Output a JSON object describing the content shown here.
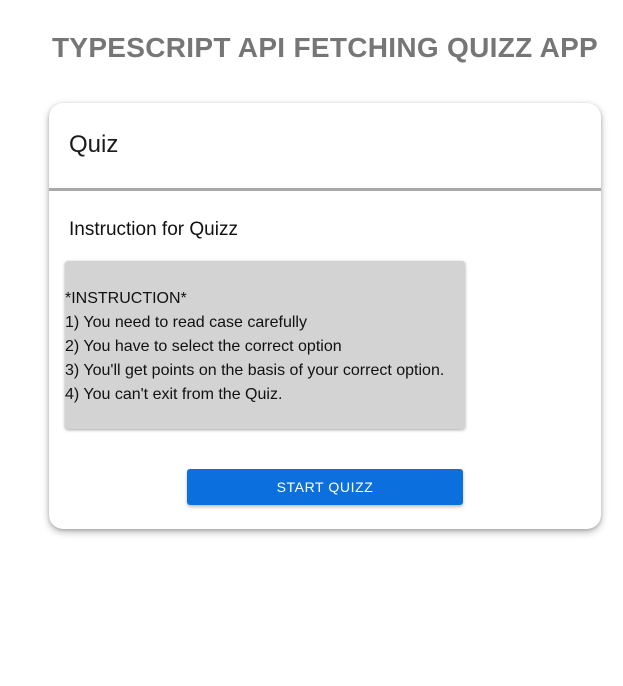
{
  "app": {
    "title": "TYPESCRIPT API FETCHING QUIZZ APP"
  },
  "card": {
    "title": "Quiz",
    "section_title": "Instruction for Quizz",
    "instructions": [
      "*INSTRUCTION*",
      "1) You need to read case carefully",
      "2) You have to select the correct option",
      "3) You'll get points on the basis of your correct option.",
      "4) You can't exit from the Quiz."
    ],
    "start_button_label": "START QUIZZ"
  },
  "colors": {
    "title_text": "#767676",
    "button_bg": "#0b6fde",
    "instruction_bg": "#d3d3d3",
    "divider": "#a9a9a9"
  }
}
